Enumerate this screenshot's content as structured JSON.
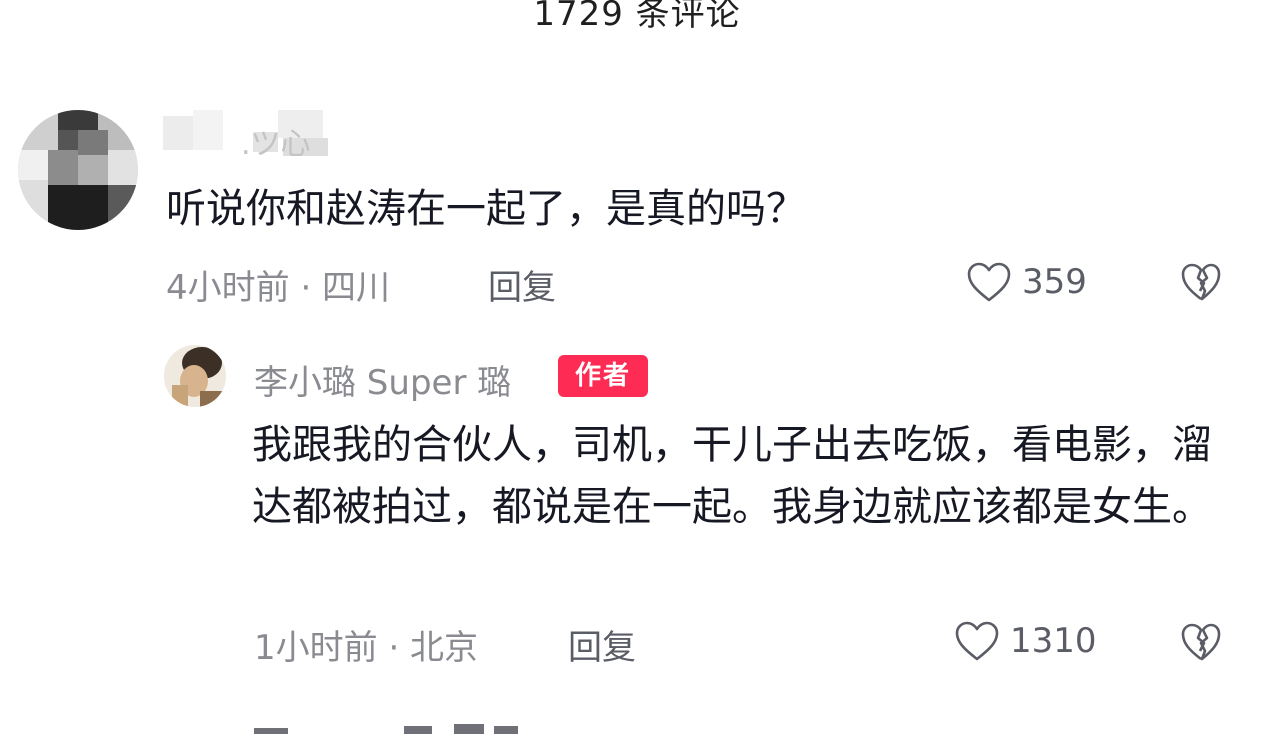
{
  "header": {
    "comment_count_title": "1729 条评论"
  },
  "comments": [
    {
      "text": "听说你和赵涛在一起了，是真的吗？",
      "time_location": "4小时前 · 四川",
      "reply_label": "回复",
      "like_count": "359",
      "replies": [
        {
          "username": "李小璐 Super 璐",
          "badge": "作者",
          "text": "我跟我的合伙人，司机，干儿子出去吃饭，看电影，溜达都被拍过，都说是在一起。我身边就应该都是女生。",
          "time_location": "1小时前 · 北京",
          "reply_label": "回复",
          "like_count": "1310"
        }
      ]
    }
  ],
  "colors": {
    "author_badge": "#fe2c55",
    "meta_text": "#8a8b91",
    "body_text": "#161823"
  }
}
